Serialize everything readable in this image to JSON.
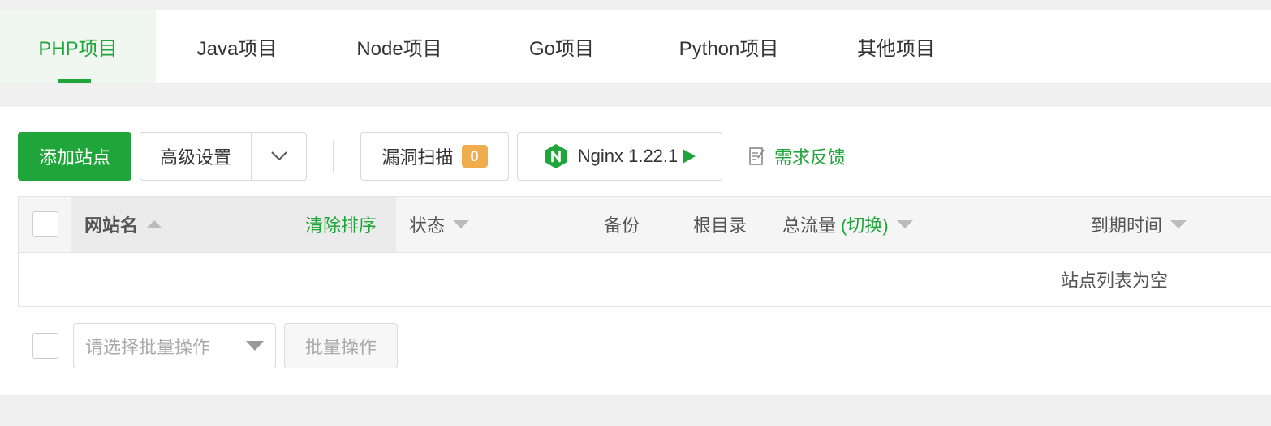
{
  "tabs": [
    {
      "label": "PHP项目"
    },
    {
      "label": "Java项目"
    },
    {
      "label": "Node项目"
    },
    {
      "label": "Go项目"
    },
    {
      "label": "Python项目"
    },
    {
      "label": "其他项目"
    }
  ],
  "toolbar": {
    "add_site": "添加站点",
    "advanced": "高级设置",
    "scan": "漏洞扫描",
    "scan_count": "0",
    "nginx": "Nginx 1.22.1",
    "feedback": "需求反馈"
  },
  "table": {
    "columns": {
      "name": "网站名",
      "clear_sort": "清除排序",
      "status": "状态",
      "backup": "备份",
      "root": "根目录",
      "traffic": "总流量",
      "traffic_switch": "(切换)",
      "expire": "到期时间"
    },
    "empty": "站点列表为空"
  },
  "batch": {
    "placeholder": "请选择批量操作",
    "button": "批量操作"
  },
  "colors": {
    "accent": "#20a53a",
    "badge": "#f0ad4e"
  },
  "icons": {
    "dropdown": "chevron-down-icon",
    "nginx": "nginx-logo-icon",
    "play": "play-icon",
    "feedback": "edit-note-icon",
    "sort": "sort-caret-icon"
  }
}
